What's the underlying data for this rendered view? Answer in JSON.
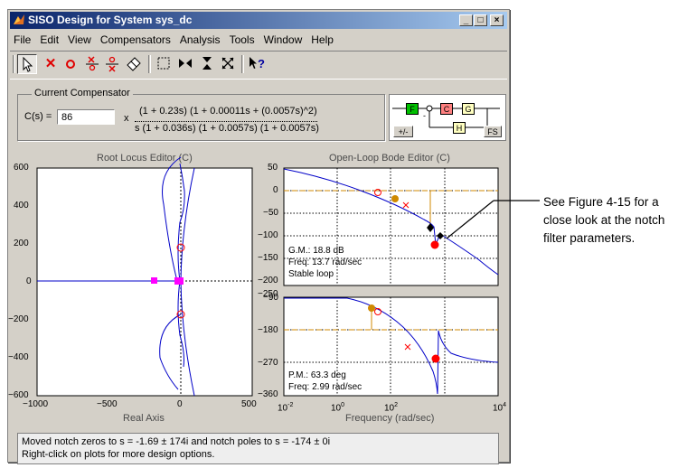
{
  "window": {
    "title": "SISO Design for System sys_dc",
    "minimize": "_",
    "maximize": "□",
    "close": "×"
  },
  "menu": [
    "File",
    "Edit",
    "View",
    "Compensators",
    "Analysis",
    "Tools",
    "Window",
    "Help"
  ],
  "compensator": {
    "group_label": "Current Compensator",
    "cs_label": "C(s) =",
    "gain": "86",
    "times": "x",
    "numerator": "(1 + 0.23s) (1 + 0.00011s + (0.0057s)^2)",
    "denominator": "s (1 + 0.036s) (1 + 0.0057s) (1 + 0.0057s)"
  },
  "structure": {
    "F": "F",
    "C": "C",
    "G": "G",
    "H": "H",
    "plus_minus": "+/-",
    "fs": "FS",
    "sign": "-"
  },
  "root_locus": {
    "title": "Root Locus Editor (C)",
    "xlabel": "Real Axis",
    "yticks": [
      "600",
      "400",
      "200",
      "0",
      "−200",
      "−400",
      "−600"
    ],
    "xticks": [
      "−1000",
      "−500",
      "0",
      "500"
    ]
  },
  "bode_mag": {
    "title": "Open-Loop Bode Editor (C)",
    "yticks": [
      "50",
      "0",
      "−50",
      "−100",
      "−150",
      "−200",
      "−250"
    ],
    "gm": "G.M.: 18.8 dB",
    "freq": "Freq: 13.7 rad/sec",
    "stable": "Stable loop"
  },
  "bode_phase": {
    "yticks": [
      "−90",
      "−180",
      "−270",
      "−360"
    ],
    "pm": "P.M.: 63.3 deg",
    "freq": "Freq: 2.99 rad/sec",
    "xlabel": "Frequency (rad/sec)",
    "xtick_base": "10",
    "xtick_exps": [
      "-2",
      "0",
      "2",
      "4"
    ]
  },
  "status": {
    "line1": "Moved notch zeros to s = -1.69 ± 174i and notch poles to s = -174 ± 0i",
    "line2": "Right-click on plots for more design options."
  },
  "annotation": {
    "line1": "See Figure 4-15 for a",
    "line2": "close look at the notch",
    "line3": "filter parameters."
  },
  "colors": {
    "curve": "#0000c8",
    "pole": "#ff0000",
    "zero": "#ff0000",
    "magenta": "#ff00ff",
    "orange": "#d08a00",
    "guide": "#d08a00",
    "title_blue": "#0a246a"
  }
}
